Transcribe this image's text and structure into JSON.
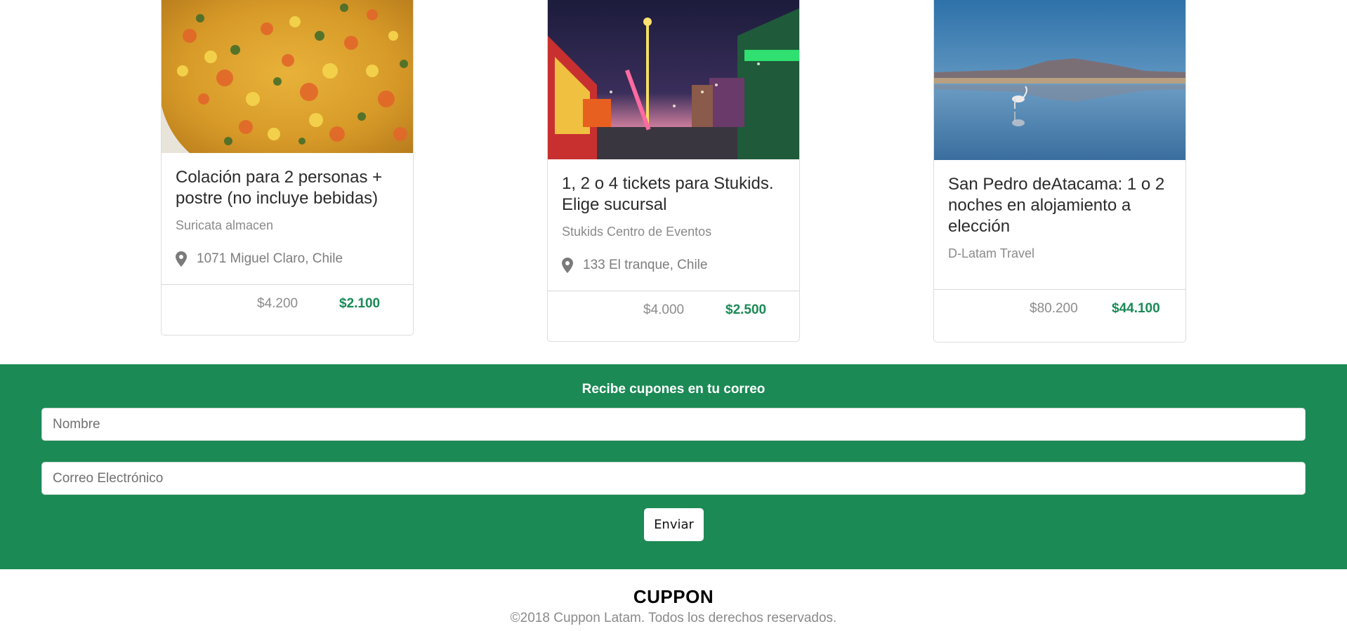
{
  "cards": [
    {
      "title": "Colación para 2 personas + postre (no incluye bebidas)",
      "merchant": "Suricata almacen",
      "location": "1071 Miguel Claro, Chile",
      "old_price": "$4.200",
      "new_price": "$2.100",
      "image": "food-photo"
    },
    {
      "title": "1, 2 o 4 tickets para Stukids. Elige sucursal",
      "merchant": "Stukids Centro de Eventos",
      "location": "133 El tranque, Chile",
      "old_price": "$4.000",
      "new_price": "$2.500",
      "image": "amusement-park-photo"
    },
    {
      "title": "San Pedro deAtacama: 1 o 2 noches en alojamiento a elección",
      "merchant": "D-Latam Travel",
      "location": "",
      "old_price": "$80.200",
      "new_price": "$44.100",
      "image": "flamingo-lake-photo"
    }
  ],
  "newsletter": {
    "heading": "Recibe cupones en tu correo",
    "name_placeholder": "Nombre",
    "email_placeholder": "Correo Electrónico",
    "submit_label": "Enviar"
  },
  "footer": {
    "brand": "CUPPON",
    "copyright": "©2018 Cuppon Latam. Todos los derechos reservados."
  },
  "colors": {
    "accent": "#1b8a55",
    "price_green": "#1a8a55"
  }
}
